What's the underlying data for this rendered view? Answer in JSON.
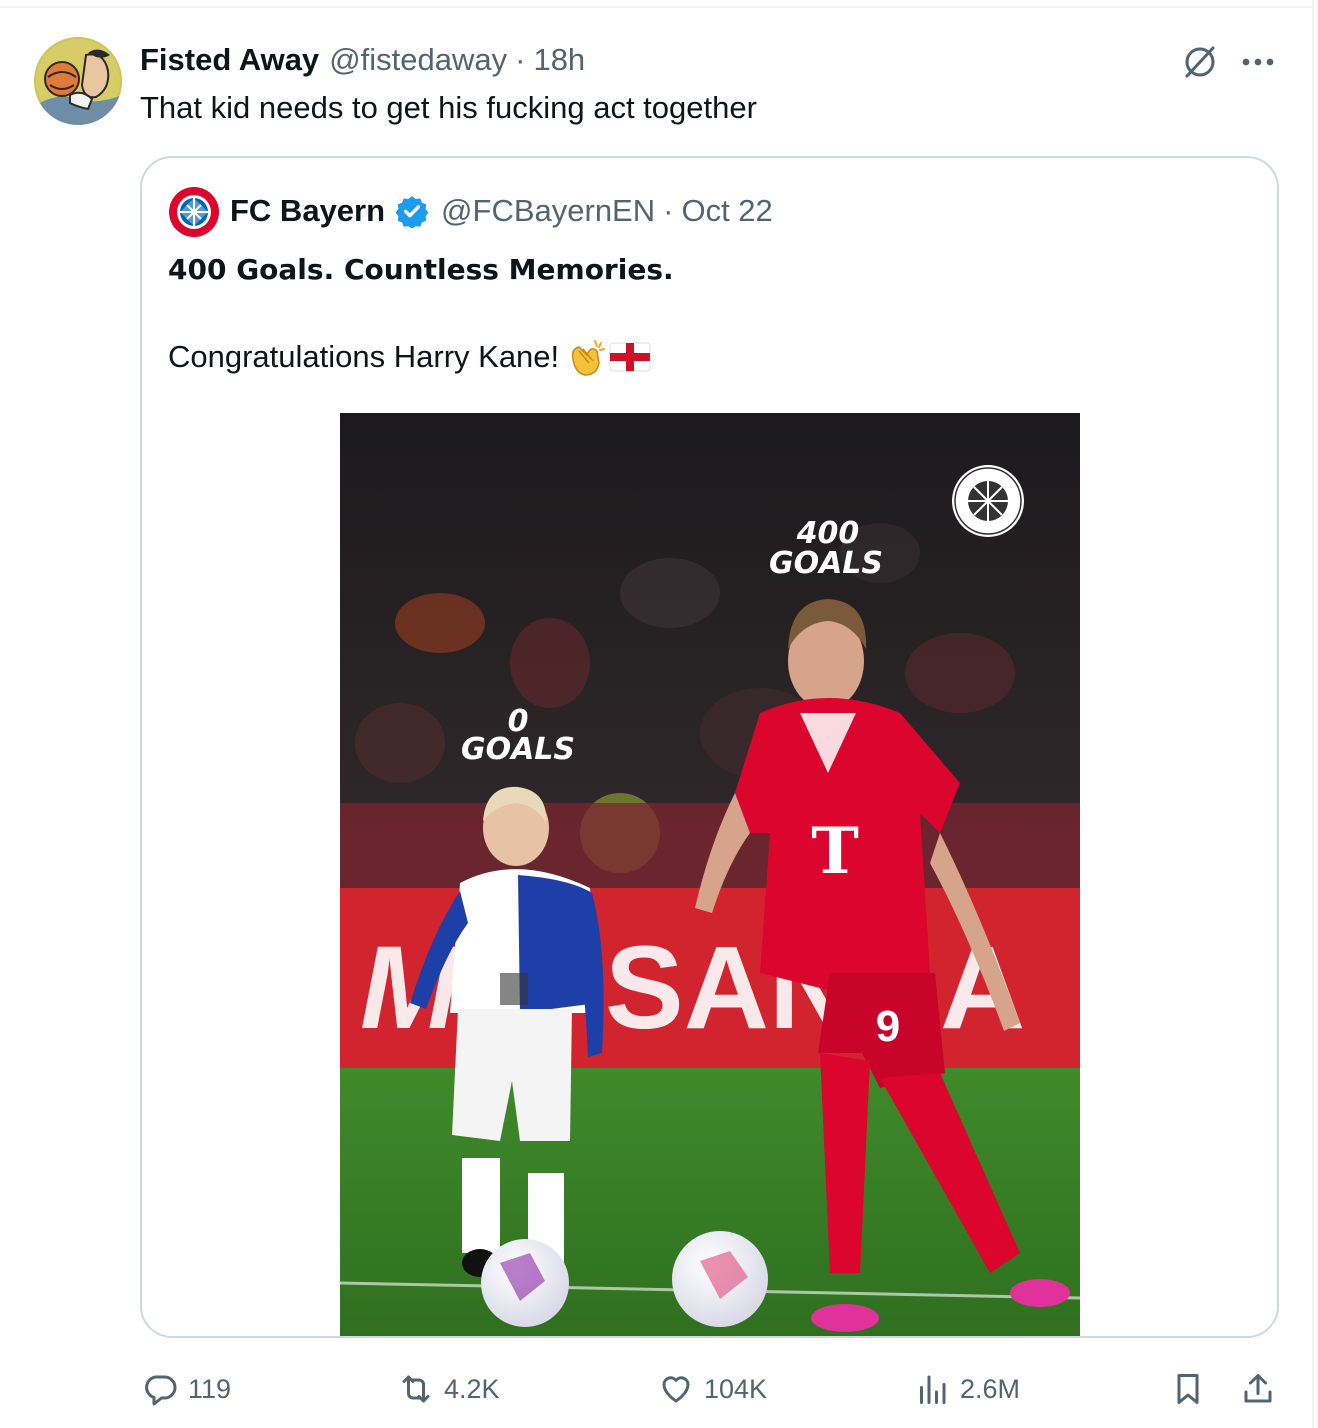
{
  "tweet": {
    "author": {
      "display_name": "Fisted Away",
      "handle": "@fistedaway",
      "separator": "·",
      "time": "18h"
    },
    "text": "That kid needs to get his fucking act together",
    "icons": {
      "grok": "grok-icon",
      "more": "more-icon"
    }
  },
  "quote": {
    "author": {
      "display_name": "FC Bayern",
      "handle": "@FCBayernEN",
      "separator": "·",
      "time": "Oct 22",
      "verified_color": "#1d9bf0",
      "badge_text": "FC BAYERN MÜNCHEN"
    },
    "line1": "400 Goals. Countless Memories.",
    "line2": "Congratulations Harry Kane!",
    "emojis": [
      "clapping-hands",
      "england-flag"
    ],
    "media": {
      "left_caption_number": "0",
      "left_caption_word": "GOALS",
      "right_caption_number": "400",
      "right_caption_word": "GOALS",
      "crest_text": "FC BAYERN MÜNCHEN",
      "banner_text": "SAN",
      "shirt_letter": "T",
      "shirt_number": "9"
    }
  },
  "actions": {
    "replies": "119",
    "reposts": "4.2K",
    "likes": "104K",
    "views": "2.6M"
  },
  "colors": {
    "text_primary": "#0f1419",
    "text_secondary": "#536471",
    "border": "#cfd9de",
    "accent": "#1d9bf0",
    "bayern_red": "#dc052d"
  }
}
